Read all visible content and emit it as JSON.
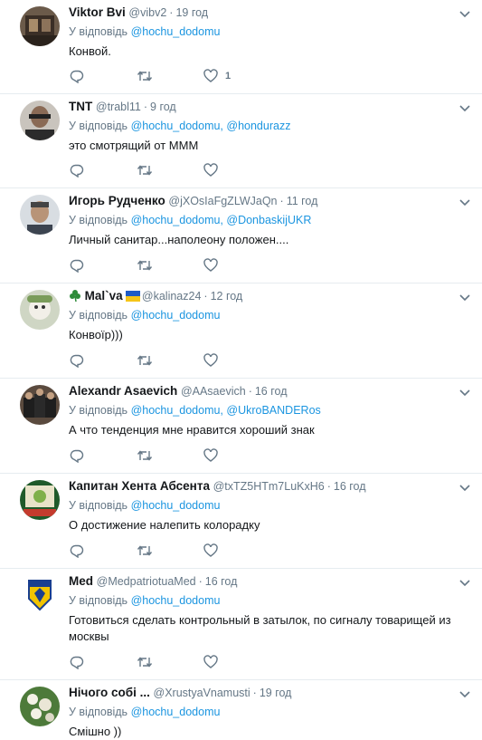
{
  "reply_prefix": "У відповідь",
  "icons": {
    "more": "chevron-down-icon",
    "reply": "reply-icon",
    "retweet": "retweet-icon",
    "like": "heart-icon"
  },
  "colors": {
    "link": "#1b95e0",
    "muted": "#657786",
    "text": "#14171a",
    "border": "#e6ecf0"
  },
  "tweets": [
    {
      "name": "Viktor Bvi",
      "handle": "@vibv2",
      "time": "19 год",
      "mentions": [
        "@hochu_dodomu"
      ],
      "text": "Конвой.",
      "likes": "1"
    },
    {
      "name": "TNT",
      "handle": "@trabl11",
      "time": "9 год",
      "mentions": [
        "@hochu_dodomu,",
        "@hondurazz"
      ],
      "text": "это смотрящий от МММ",
      "likes": ""
    },
    {
      "name": "Игорь Рудченко",
      "handle": "@jXOsIaFgZLWJaQn",
      "time": "11 год",
      "mentions": [
        "@hochu_dodomu,",
        "@DonbaskijUKR"
      ],
      "text": "Личный санитар...наполеону положен....",
      "likes": ""
    },
    {
      "name": "Mal`va",
      "handle": "@kalinaz24",
      "time": "12 год",
      "mentions": [
        "@hochu_dodomu"
      ],
      "text": "Конвоїр)))",
      "likes": ""
    },
    {
      "name": "Alexandr Asaevich",
      "handle": "@AAsaevich",
      "time": "16 год",
      "mentions": [
        "@hochu_dodomu,",
        "@UkroBANDERos"
      ],
      "text": "А что тенденция мне нравится хороший знак",
      "likes": ""
    },
    {
      "name": "Капитан Хента Абсента",
      "handle": "@txTZ5HTm7LuKxH6",
      "time": "16 год",
      "mentions": [
        "@hochu_dodomu"
      ],
      "text": "О достижение налепить колорадку",
      "likes": ""
    },
    {
      "name": "Med",
      "handle": "@MedpatriotuaMed",
      "time": "16 год",
      "mentions": [
        "@hochu_dodomu"
      ],
      "text": "Готовиться сделать контрольный в затылок, по сигналу товарищей из москвы",
      "likes": ""
    },
    {
      "name": "Нічого собі ...",
      "handle": "@XrustyaVnamusti",
      "time": "19 год",
      "mentions": [
        "@hochu_dodomu"
      ],
      "text": "Смішно ))",
      "likes": ""
    }
  ]
}
